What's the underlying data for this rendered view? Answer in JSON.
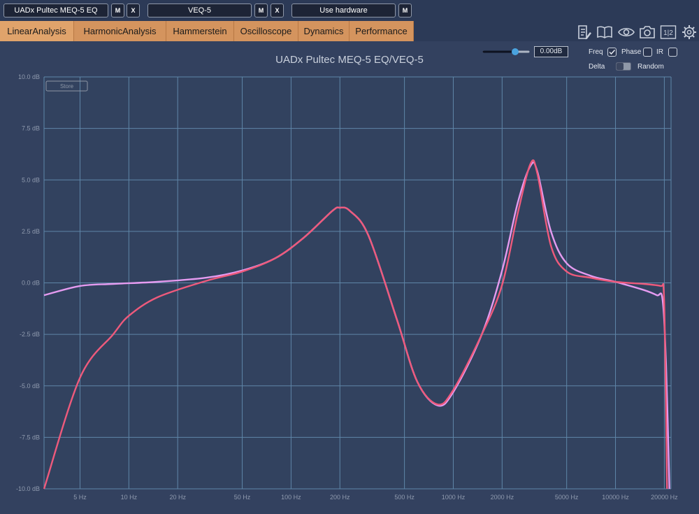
{
  "slots": [
    {
      "label": "UADx Pultec MEQ-5 EQ",
      "m": "M",
      "x": "X"
    },
    {
      "label": "VEQ-5",
      "m": "M",
      "x": "X"
    },
    {
      "label": "Use hardware",
      "m": "M"
    }
  ],
  "tabs": [
    "LinearAnalysis",
    "HarmonicAnalysis",
    "Hammerstein",
    "Oscilloscope",
    "Dynamics",
    "Performance"
  ],
  "active_tab": "LinearAnalysis",
  "toolbar_icons": [
    "notes-icon",
    "book-icon",
    "eye-icon",
    "camera-icon",
    "split-1-2-icon",
    "gear-icon"
  ],
  "split_icon_text": "1|2",
  "gain_value": "0.00dB",
  "options": {
    "freq_label": "Freq",
    "freq_checked": true,
    "phase_label": "Phase",
    "phase_checked": false,
    "ir_label": "IR",
    "ir_checked": false,
    "delta_label": "Delta",
    "delta_on": false,
    "random_label": "Random"
  },
  "store_label": "Store",
  "colors": {
    "pink": "#ee5a7c",
    "lavender": "#e59bf0",
    "accent": "#4aa3df"
  },
  "chart_data": {
    "type": "line",
    "title": "UADx Pultec MEQ-5 EQ/VEQ-5",
    "xscale": "log",
    "xlim": [
      3,
      22000
    ],
    "ylim": [
      -10,
      10
    ],
    "x_ticks": [
      5,
      10,
      20,
      50,
      100,
      200,
      500,
      1000,
      2000,
      5000,
      10000,
      20000
    ],
    "x_tick_labels": [
      "5 Hz",
      "10 Hz",
      "20 Hz",
      "50 Hz",
      "100 Hz",
      "200 Hz",
      "500 Hz",
      "1000 Hz",
      "2000 Hz",
      "5000 Hz",
      "10000 Hz",
      "20000 Hz"
    ],
    "y_ticks": [
      10,
      7.5,
      5,
      2.5,
      0,
      -2.5,
      -5,
      -7.5,
      -10
    ],
    "y_tick_labels": [
      "10.0 dB",
      "7.5 dB",
      "5.0 dB",
      "2.5 dB",
      "0.0 dB",
      "-2.5 dB",
      "-5.0 dB",
      "-7.5 dB",
      "-10.0 dB"
    ],
    "grid": true,
    "series": [
      {
        "color": "#e59bf0",
        "x": [
          3,
          5,
          8,
          15,
          30,
          50,
          80,
          120,
          180,
          200,
          230,
          300,
          450,
          600,
          800,
          1000,
          1500,
          2000,
          2500,
          3000,
          3300,
          4000,
          5000,
          7000,
          10000,
          15000,
          18000,
          19500,
          20500,
          21500
        ],
        "y": [
          -0.6,
          -0.15,
          -0.05,
          0.05,
          0.25,
          0.6,
          1.2,
          2.2,
          3.5,
          3.65,
          3.5,
          2.3,
          -1.8,
          -4.8,
          -5.95,
          -5.3,
          -2.5,
          0.6,
          3.9,
          5.7,
          5.4,
          2.5,
          0.95,
          0.35,
          0.05,
          -0.35,
          -0.6,
          -0.8,
          -4,
          -10
        ]
      },
      {
        "color": "#ee5a7c",
        "x": [
          3,
          5,
          8,
          10,
          15,
          30,
          50,
          80,
          120,
          180,
          200,
          230,
          300,
          450,
          600,
          800,
          1000,
          1500,
          2000,
          2500,
          3000,
          3300,
          4000,
          5000,
          7000,
          10000,
          15000,
          19000,
          19800,
          20200,
          20800
        ],
        "y": [
          -10,
          -4.6,
          -2.5,
          -1.6,
          -0.7,
          0.1,
          0.55,
          1.2,
          2.2,
          3.5,
          3.65,
          3.5,
          2.3,
          -1.8,
          -4.8,
          -5.9,
          -5.2,
          -2.5,
          -0.1,
          3.4,
          5.8,
          5.3,
          1.8,
          0.55,
          0.25,
          0.05,
          -0.05,
          -0.15,
          -0.3,
          -3,
          -10
        ]
      }
    ]
  }
}
